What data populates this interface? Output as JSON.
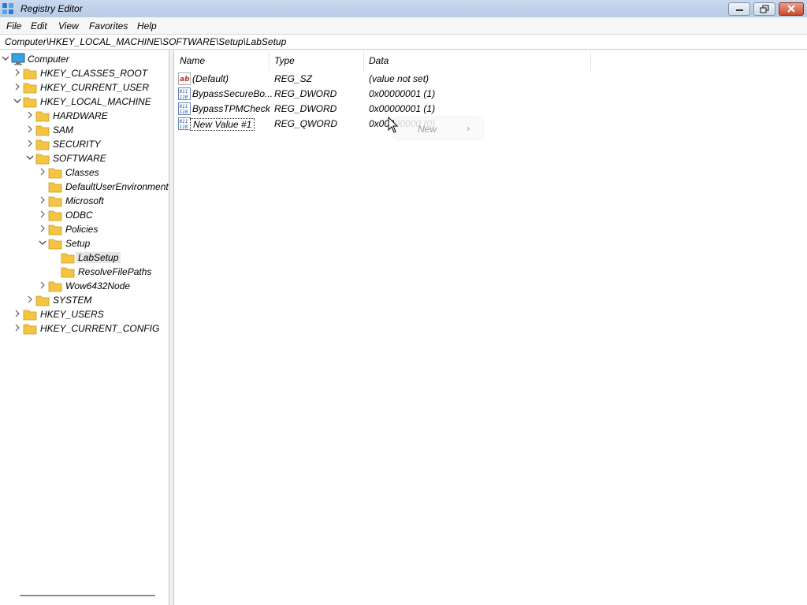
{
  "window": {
    "title": "Registry Editor"
  },
  "menu": [
    "File",
    "Edit",
    "View",
    "Favorites",
    "Help"
  ],
  "address": "Computer\\HKEY_LOCAL_MACHINE\\SOFTWARE\\Setup\\LabSetup",
  "tree": {
    "root": "Computer",
    "hkcr": "HKEY_CLASSES_ROOT",
    "hkcu": "HKEY_CURRENT_USER",
    "hklm": "HKEY_LOCAL_MACHINE",
    "hardware": "HARDWARE",
    "sam": "SAM",
    "security": "SECURITY",
    "software": "SOFTWARE",
    "classes": "Classes",
    "defaultuserenv": "DefaultUserEnvironment",
    "microsoft": "Microsoft",
    "odbc": "ODBC",
    "policies": "Policies",
    "setup": "Setup",
    "labsetup": "LabSetup",
    "resolvefilepaths": "ResolveFilePaths",
    "wow6432node": "Wow6432Node",
    "system": "SYSTEM",
    "hku": "HKEY_USERS",
    "hkcc": "HKEY_CURRENT_CONFIG"
  },
  "columns": {
    "name": "Name",
    "type": "Type",
    "data": "Data"
  },
  "values": [
    {
      "name": "(Default)",
      "type": "REG_SZ",
      "data": "(value not set)",
      "icon": "string-value-icon"
    },
    {
      "name": "BypassSecureBo...",
      "type": "REG_DWORD",
      "data": "0x00000001 (1)",
      "icon": "binary-value-icon"
    },
    {
      "name": "BypassTPMCheck",
      "type": "REG_DWORD",
      "data": "0x00000001 (1)",
      "icon": "binary-value-icon"
    },
    {
      "name": "New Value #1",
      "type": "REG_QWORD",
      "data": "0x00000000 (0)",
      "icon": "binary-value-icon"
    }
  ],
  "context_menu": {
    "label": "New",
    "arrow": "›"
  },
  "colors": {
    "title_bar": "#b7cbe6",
    "close_button": "#c94a2f",
    "folder": "#f4c542",
    "selection": "#e5e5e5"
  }
}
